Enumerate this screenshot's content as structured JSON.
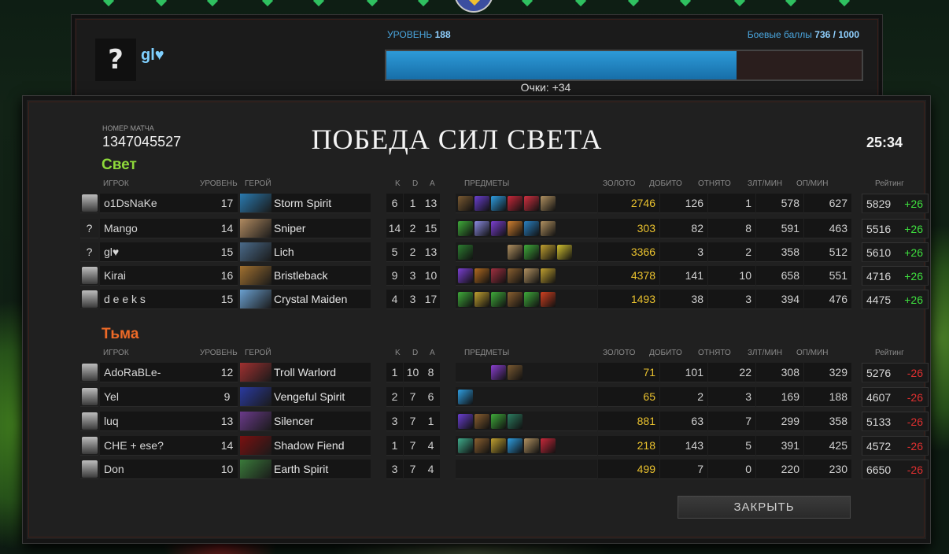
{
  "top": {
    "level_label": "УРОВЕНЬ",
    "level_value": "188",
    "battle_points_label": "Боевые баллы",
    "battle_points_value": "736 / 1000",
    "battle_points_fraction": 0.736,
    "avatar_text": "?",
    "player_name": "gl♥",
    "points_text": "Очки: +34"
  },
  "match": {
    "id_label": "НОМЕР МАТЧА",
    "id": "1347045527",
    "result_title": "ПОБЕДА СИЛ СВЕТА",
    "duration": "25:34",
    "close_label": "ЗАКРЫТЬ"
  },
  "headers": {
    "player": "ИГРОК",
    "level": "УРОВЕНЬ",
    "hero": "ГЕРОЙ",
    "k": "K",
    "d": "D",
    "a": "A",
    "items": "ПРЕДМЕТЫ",
    "gold": "ЗОЛОТО",
    "last_hits": "ДОБИТО",
    "denies": "ОТНЯТО",
    "gpm": "ЗЛТ/МИН",
    "xpm": "ОП/МИН",
    "rating": "Рейтинг"
  },
  "teams": [
    {
      "name": "Свет",
      "color": "#8ed93a",
      "players": [
        {
          "avatar": "",
          "player": "o1DsNaKe",
          "level": "17",
          "hero": "Storm Spirit",
          "k": "6",
          "d": "1",
          "a": "13",
          "gold": "2746",
          "lh": "126",
          "dn": "1",
          "gpm": "578",
          "xpm": "627",
          "rating": "5829",
          "change": "+26"
        },
        {
          "avatar": "?",
          "player": "Mango",
          "level": "14",
          "hero": "Sniper",
          "k": "14",
          "d": "2",
          "a": "15",
          "gold": "303",
          "lh": "82",
          "dn": "8",
          "gpm": "591",
          "xpm": "463",
          "rating": "5516",
          "change": "+26"
        },
        {
          "avatar": "?",
          "player": "gl♥",
          "level": "15",
          "hero": "Lich",
          "k": "5",
          "d": "2",
          "a": "13",
          "gold": "3366",
          "lh": "3",
          "dn": "2",
          "gpm": "358",
          "xpm": "512",
          "rating": "5610",
          "change": "+26"
        },
        {
          "avatar": "",
          "player": "Kirai",
          "level": "16",
          "hero": "Bristleback",
          "k": "9",
          "d": "3",
          "a": "10",
          "gold": "4378",
          "lh": "141",
          "dn": "10",
          "gpm": "658",
          "xpm": "551",
          "rating": "4716",
          "change": "+26"
        },
        {
          "avatar": "",
          "player": "d e e k s",
          "level": "15",
          "hero": "Crystal Maiden",
          "k": "4",
          "d": "3",
          "a": "17",
          "gold": "1493",
          "lh": "38",
          "dn": "3",
          "gpm": "394",
          "xpm": "476",
          "rating": "4475",
          "change": "+26"
        }
      ]
    },
    {
      "name": "Тьма",
      "color": "#ee6a27",
      "players": [
        {
          "avatar": "",
          "player": "AdoRaBLe-",
          "level": "12",
          "hero": "Troll Warlord",
          "k": "1",
          "d": "10",
          "a": "8",
          "gold": "71",
          "lh": "101",
          "dn": "22",
          "gpm": "308",
          "xpm": "329",
          "rating": "5276",
          "change": "-26"
        },
        {
          "avatar": "",
          "player": "Yel",
          "level": "9",
          "hero": "Vengeful Spirit",
          "k": "2",
          "d": "7",
          "a": "6",
          "gold": "65",
          "lh": "2",
          "dn": "3",
          "gpm": "169",
          "xpm": "188",
          "rating": "4607",
          "change": "-26"
        },
        {
          "avatar": "",
          "player": "luq",
          "level": "13",
          "hero": "Silencer",
          "k": "3",
          "d": "7",
          "a": "1",
          "gold": "881",
          "lh": "63",
          "dn": "7",
          "gpm": "299",
          "xpm": "358",
          "rating": "5133",
          "change": "-26"
        },
        {
          "avatar": "",
          "player": "CHE + ese?",
          "level": "14",
          "hero": "Shadow Fiend",
          "k": "1",
          "d": "7",
          "a": "4",
          "gold": "218",
          "lh": "143",
          "dn": "5",
          "gpm": "391",
          "xpm": "425",
          "rating": "4572",
          "change": "-26"
        },
        {
          "avatar": "",
          "player": "Don",
          "level": "10",
          "hero": "Earth Spirit",
          "k": "3",
          "d": "7",
          "a": "4",
          "gold": "499",
          "lh": "7",
          "dn": "0",
          "gpm": "220",
          "xpm": "230",
          "rating": "6650",
          "change": "-26"
        }
      ]
    }
  ]
}
